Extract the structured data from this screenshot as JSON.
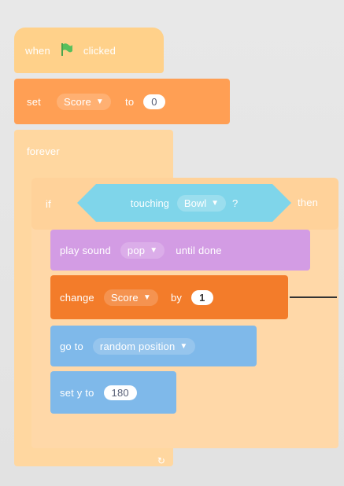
{
  "colors": {
    "events": "#ffd18a",
    "control": "#ffd7a0",
    "variables": "#ff9f54",
    "variables_active": "#f37c2a",
    "sound": "#d39ce4",
    "motion": "#7fb9ea",
    "sensing": "#7fd5ea"
  },
  "when_flag_block": {
    "left_text": "when",
    "icon": "green-flag-icon",
    "right_text": "clicked"
  },
  "set_block": {
    "label": "set",
    "variable": "Score",
    "to_label": "to",
    "value": "0"
  },
  "forever_block": {
    "label": "forever"
  },
  "if_block": {
    "label": "if",
    "condition": {
      "label": "touching",
      "option": "Bowl",
      "qmark": "?"
    },
    "then_label": "then"
  },
  "play_sound_block": {
    "label": "play sound",
    "sound": "pop",
    "suffix": "until done"
  },
  "change_block": {
    "label": "change",
    "variable": "Score",
    "by_label": "by",
    "value": "1"
  },
  "go_to_block": {
    "label": "go to",
    "target": "random position"
  },
  "set_y_block": {
    "label": "set y to",
    "value": "180"
  },
  "forever_end": {
    "arrow": "↻"
  }
}
